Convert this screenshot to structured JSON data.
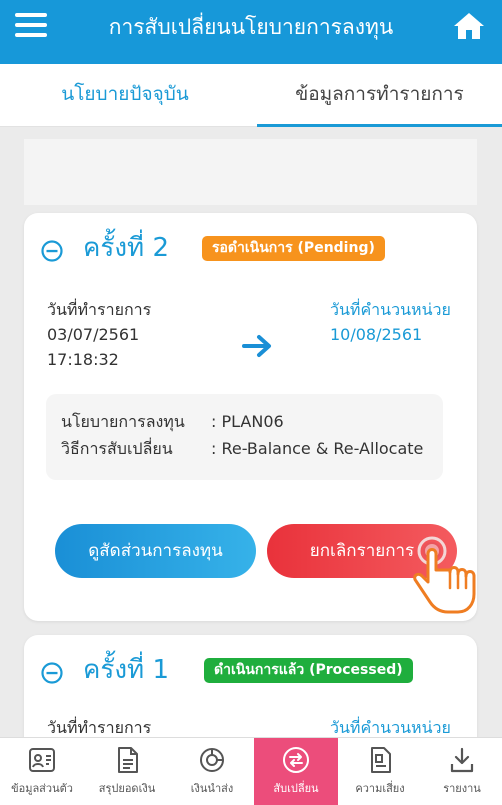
{
  "header": {
    "title": "การสับเปลี่ยนนโยบายการลงทุน",
    "menu_icon": "hamburger-menu-icon",
    "home_icon": "home-icon"
  },
  "tabs": [
    {
      "label": "นโยบายปัจจุบัน",
      "active": false
    },
    {
      "label": "ข้อมูลการทำรายการ",
      "active": true
    }
  ],
  "transactions": [
    {
      "round": "ครั้งที่ 2",
      "status": "รอดำเนินการ (Pending)",
      "status_color": "#f7931d",
      "transaction_date_label": "วันที่ทำรายการ",
      "transaction_date": "03/07/2561",
      "transaction_time": "17:18:32",
      "calc_date_label": "วันที่คำนวนหน่วย",
      "calc_date": "10/08/2561",
      "policy_label": "นโยบายการลงทุน",
      "policy_value": ": PLAN06",
      "method_label": "วิธีการสับเปลี่ยน",
      "method_value": ": Re-Balance & Re-Allocate",
      "view_button": "ดูสัดส่วนการลงทุน",
      "cancel_button": "ยกเลิกรายการ"
    },
    {
      "round": "ครั้งที่ 1",
      "status": "ดำเนินการแล้ว (Processed)",
      "status_color": "#1fae3d",
      "transaction_date_label": "วันที่ทำรายการ",
      "calc_date_label": "วันที่คำนวนหน่วย"
    }
  ],
  "bottom_nav": [
    {
      "label": "ข้อมูลส่วนตัว",
      "icon": "profile-card-icon",
      "active": false
    },
    {
      "label": "สรุปยอดเงิน",
      "icon": "document-summary-icon",
      "active": false
    },
    {
      "label": "เงินนำส่ง",
      "icon": "pie-chart-icon",
      "active": false
    },
    {
      "label": "สับเปลี่ยน",
      "icon": "switch-arrows-icon",
      "active": true
    },
    {
      "label": "ความเสี่ยง",
      "icon": "risk-document-icon",
      "active": false
    },
    {
      "label": "รายงาน",
      "icon": "download-report-icon",
      "active": false
    }
  ],
  "colors": {
    "primary": "#1798d9",
    "pending": "#f7931d",
    "processed": "#1fae3d",
    "cancel": "#e9323b",
    "nav_active": "#ec4d7b"
  }
}
